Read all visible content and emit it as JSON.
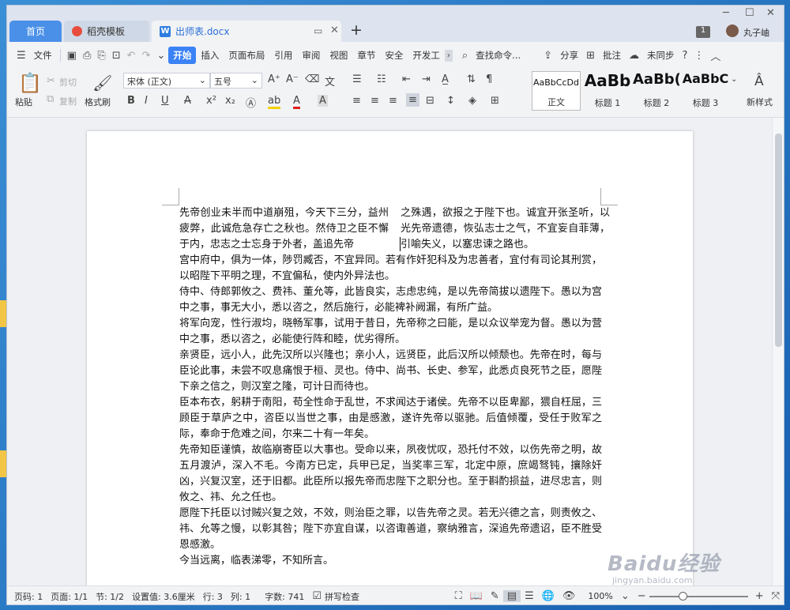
{
  "tabs": {
    "home": "首页",
    "template": "稻壳模板",
    "document": "出师表.docx",
    "new_tab": "+"
  },
  "window": {
    "badge": "1",
    "user": "丸子岫"
  },
  "menu": {
    "file": "文件",
    "items": [
      "开始",
      "插入",
      "页面布局",
      "引用",
      "审阅",
      "视图",
      "章节",
      "安全",
      "开发工"
    ],
    "search": "查找命令...",
    "share": "分享",
    "comment": "批注",
    "sync": "未同步"
  },
  "ribbon": {
    "paste": "粘贴",
    "cut": "剪切",
    "copy": "复制",
    "format_painter": "格式刷",
    "font_name": "宋体 (正文)",
    "font_size": "五号",
    "styles": [
      {
        "preview": "AaBbCcDd",
        "label": "正文"
      },
      {
        "preview": "AaBb",
        "label": "标题 1"
      },
      {
        "preview": "AaBb(",
        "label": "标题 2"
      },
      {
        "preview": "AaBbC",
        "label": "标题 3"
      }
    ],
    "new_style": "新样式"
  },
  "document": {
    "col1": "先帝创业未半而中道崩殂，今天下三分，益州疲弊，此诚危急存亡之秋也。然侍卫之臣不懈于内，忠志之士忘身于外者，盖追先帝",
    "col2": "之殊遇，欲报之于陛下也。诚宜开张圣听，以光先帝遗德，恢弘志士之气，不宜妄自菲薄，引喻失义，以塞忠谏之路也。",
    "paragraphs": [
      "宫中府中，俱为一体，陟罚臧否，不宜异同。若有作奸犯科及为忠善者，宜付有司论其刑赏，以昭陛下平明之理，不宜偏私，使内外异法也。",
      "侍中、侍郎郭攸之、费祎、董允等，此皆良实，志虑忠纯，是以先帝简拔以遗陛下。愚以为宫中之事，事无大小，悉以咨之，然后施行，必能裨补阙漏，有所广益。",
      "将军向宠，性行淑均，晓畅军事，试用于昔日，先帝称之曰能，是以众议举宠为督。愚以为营中之事，悉以咨之，必能使行阵和睦，优劣得所。",
      "亲贤臣，远小人，此先汉所以兴隆也；亲小人，远贤臣，此后汉所以倾颓也。先帝在时，每与臣论此事，未尝不叹息痛恨于桓、灵也。侍中、尚书、长史、参军，此悉贞良死节之臣，愿陛下亲之信之，则汉室之隆，可计日而待也。",
      "臣本布衣，躬耕于南阳，苟全性命于乱世，不求闻达于诸侯。先帝不以臣卑鄙，猥自枉屈，三顾臣于草庐之中，咨臣以当世之事，由是感激，遂许先帝以驱驰。后值倾覆，受任于败军之际，奉命于危难之间，尔来二十有一年矣。",
      "先帝知臣谨慎，故临崩寄臣以大事也。受命以来，夙夜忧叹，恐托付不效，以伤先帝之明，故五月渡泸，深入不毛。今南方已定，兵甲已足，当奖率三军，北定中原，庶竭驽钝，攘除奸凶，兴复汉室，还于旧都。此臣所以报先帝而忠陛下之职分也。至于斟酌损益，进尽忠言，则攸之、祎、允之任也。",
      "愿陛下托臣以讨贼兴复之效，不效，则治臣之罪，以告先帝之灵。若无兴德之言，则责攸之、祎、允等之慢，以彰其咎；陛下亦宜自谋，以咨诹善道，察纳雅言，深追先帝遗诏，臣不胜受恩感激。",
      "今当远离，临表涕零，不知所言。"
    ]
  },
  "statusbar": {
    "page_no": "页码: 1",
    "pages": "页面: 1/1",
    "section": "节: 1/2",
    "setting": "设置值: 3.6厘米",
    "row": "行: 3",
    "col": "列: 1",
    "words": "字数: 741",
    "spell": "拼写检查",
    "zoom": "100%"
  },
  "watermark": {
    "brand": "Baidu经验",
    "url": "jingyan.baidu.com"
  }
}
